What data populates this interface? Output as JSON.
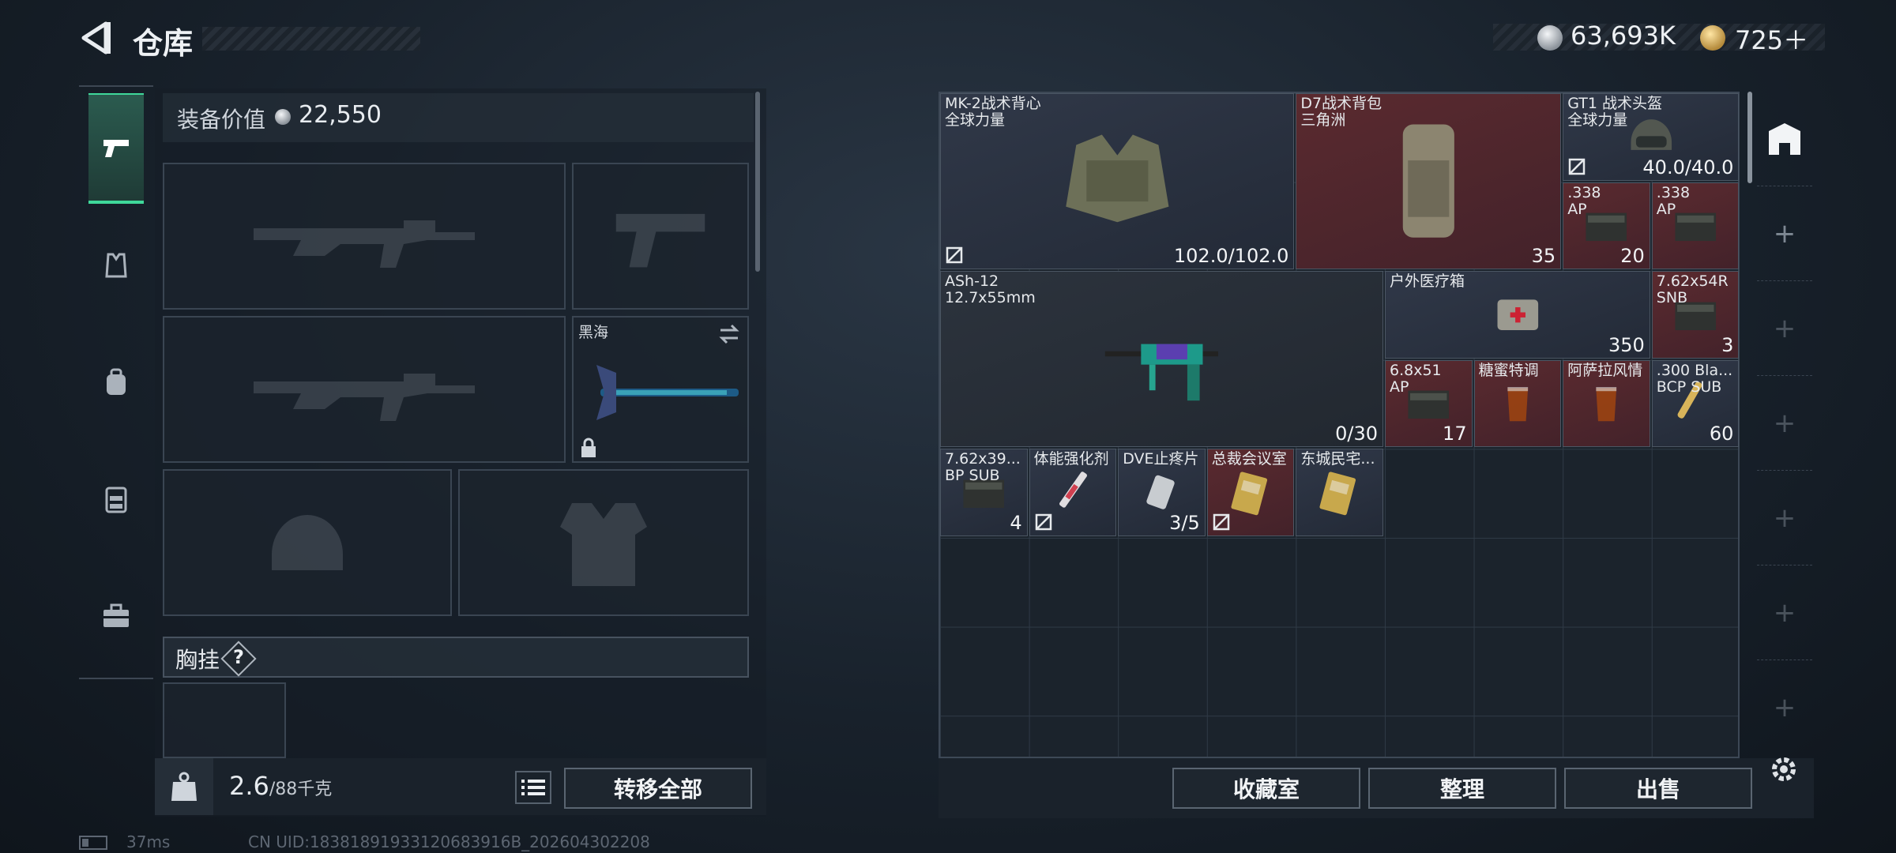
{
  "header": {
    "title": "仓库",
    "currency1": "63,693K",
    "currency2": "725＋"
  },
  "sidebar": {
    "tabs": [
      {
        "name": "weapons-tab",
        "icon": "pistol-icon"
      },
      {
        "name": "armor-tab",
        "icon": "vest-icon"
      },
      {
        "name": "backpack-tab",
        "icon": "backpack-icon"
      },
      {
        "name": "rig-tab",
        "icon": "rig-icon"
      },
      {
        "name": "case-tab",
        "icon": "case-icon"
      }
    ]
  },
  "equipment": {
    "value_label": "装备价值",
    "value": "22,550",
    "melee_name": "黑海",
    "chest_rig_label": "胸挂",
    "chest_rig_help": "?",
    "weight_value": "2.6",
    "weight_max": "/88千克",
    "transfer_all": "转移全部"
  },
  "stash": {
    "items": [
      {
        "name": "MK-2战术背心\n全球力量",
        "count": "102.0/102.0",
        "color": "blue",
        "icon": "vest-icon"
      },
      {
        "name": "D7战术背包\n三角洲",
        "count": "35",
        "color": "red",
        "icon": "backpack-icon"
      },
      {
        "name": "GT1 战术头盔\n全球力量",
        "count": "40.0/40.0",
        "color": "blue",
        "icon": "helmet-icon"
      },
      {
        "name": ".338\nAP",
        "count": "20",
        "color": "red",
        "icon": "ammo-box-icon"
      },
      {
        "name": ".338\nAP",
        "count": "",
        "color": "red",
        "icon": "ammo-box-icon"
      },
      {
        "name": "ASh-12\n12.7x55mm",
        "count": "0/30",
        "color": "dark",
        "icon": "rifle-icon"
      },
      {
        "name": "户外医疗箱",
        "count": "350",
        "color": "blue",
        "icon": "medkit-icon"
      },
      {
        "name": "7.62x54R\nSNB",
        "count": "3",
        "color": "red",
        "icon": "ammo-box-icon"
      },
      {
        "name": "6.8x51\nAP",
        "count": "17",
        "color": "red",
        "icon": "ammo-box-icon"
      },
      {
        "name": "糖蜜特调",
        "count": "",
        "color": "red",
        "icon": "drink-icon"
      },
      {
        "name": "阿萨拉风情",
        "count": "",
        "color": "red",
        "icon": "drink-icon"
      },
      {
        "name": ".300 Bla...\nBCP SUB",
        "count": "60",
        "color": "blue",
        "icon": "ammo-icon"
      },
      {
        "name": "7.62x39...\nBP SUB",
        "count": "4",
        "color": "blue",
        "icon": "ammo-box-icon"
      },
      {
        "name": "体能强化剂",
        "count": "",
        "color": "blue",
        "icon": "syringe-icon"
      },
      {
        "name": "DVE止疼片",
        "count": "3/5",
        "color": "blue",
        "icon": "pills-icon"
      },
      {
        "name": "总裁会议室",
        "count": "",
        "color": "red",
        "icon": "keycard-icon"
      },
      {
        "name": "东城民宅...",
        "count": "",
        "color": "blue",
        "icon": "keycard-icon"
      }
    ],
    "collection_btn": "收藏室",
    "sort_btn": "整理",
    "sell_btn": "出售"
  },
  "status": {
    "ping": "37ms",
    "uid": "CN UID:18381891933120683916B_202604302208"
  },
  "colors": {
    "accent": "#3fd89a",
    "red_rarity": "#5a2a2f",
    "blue_rarity": "#303848"
  }
}
